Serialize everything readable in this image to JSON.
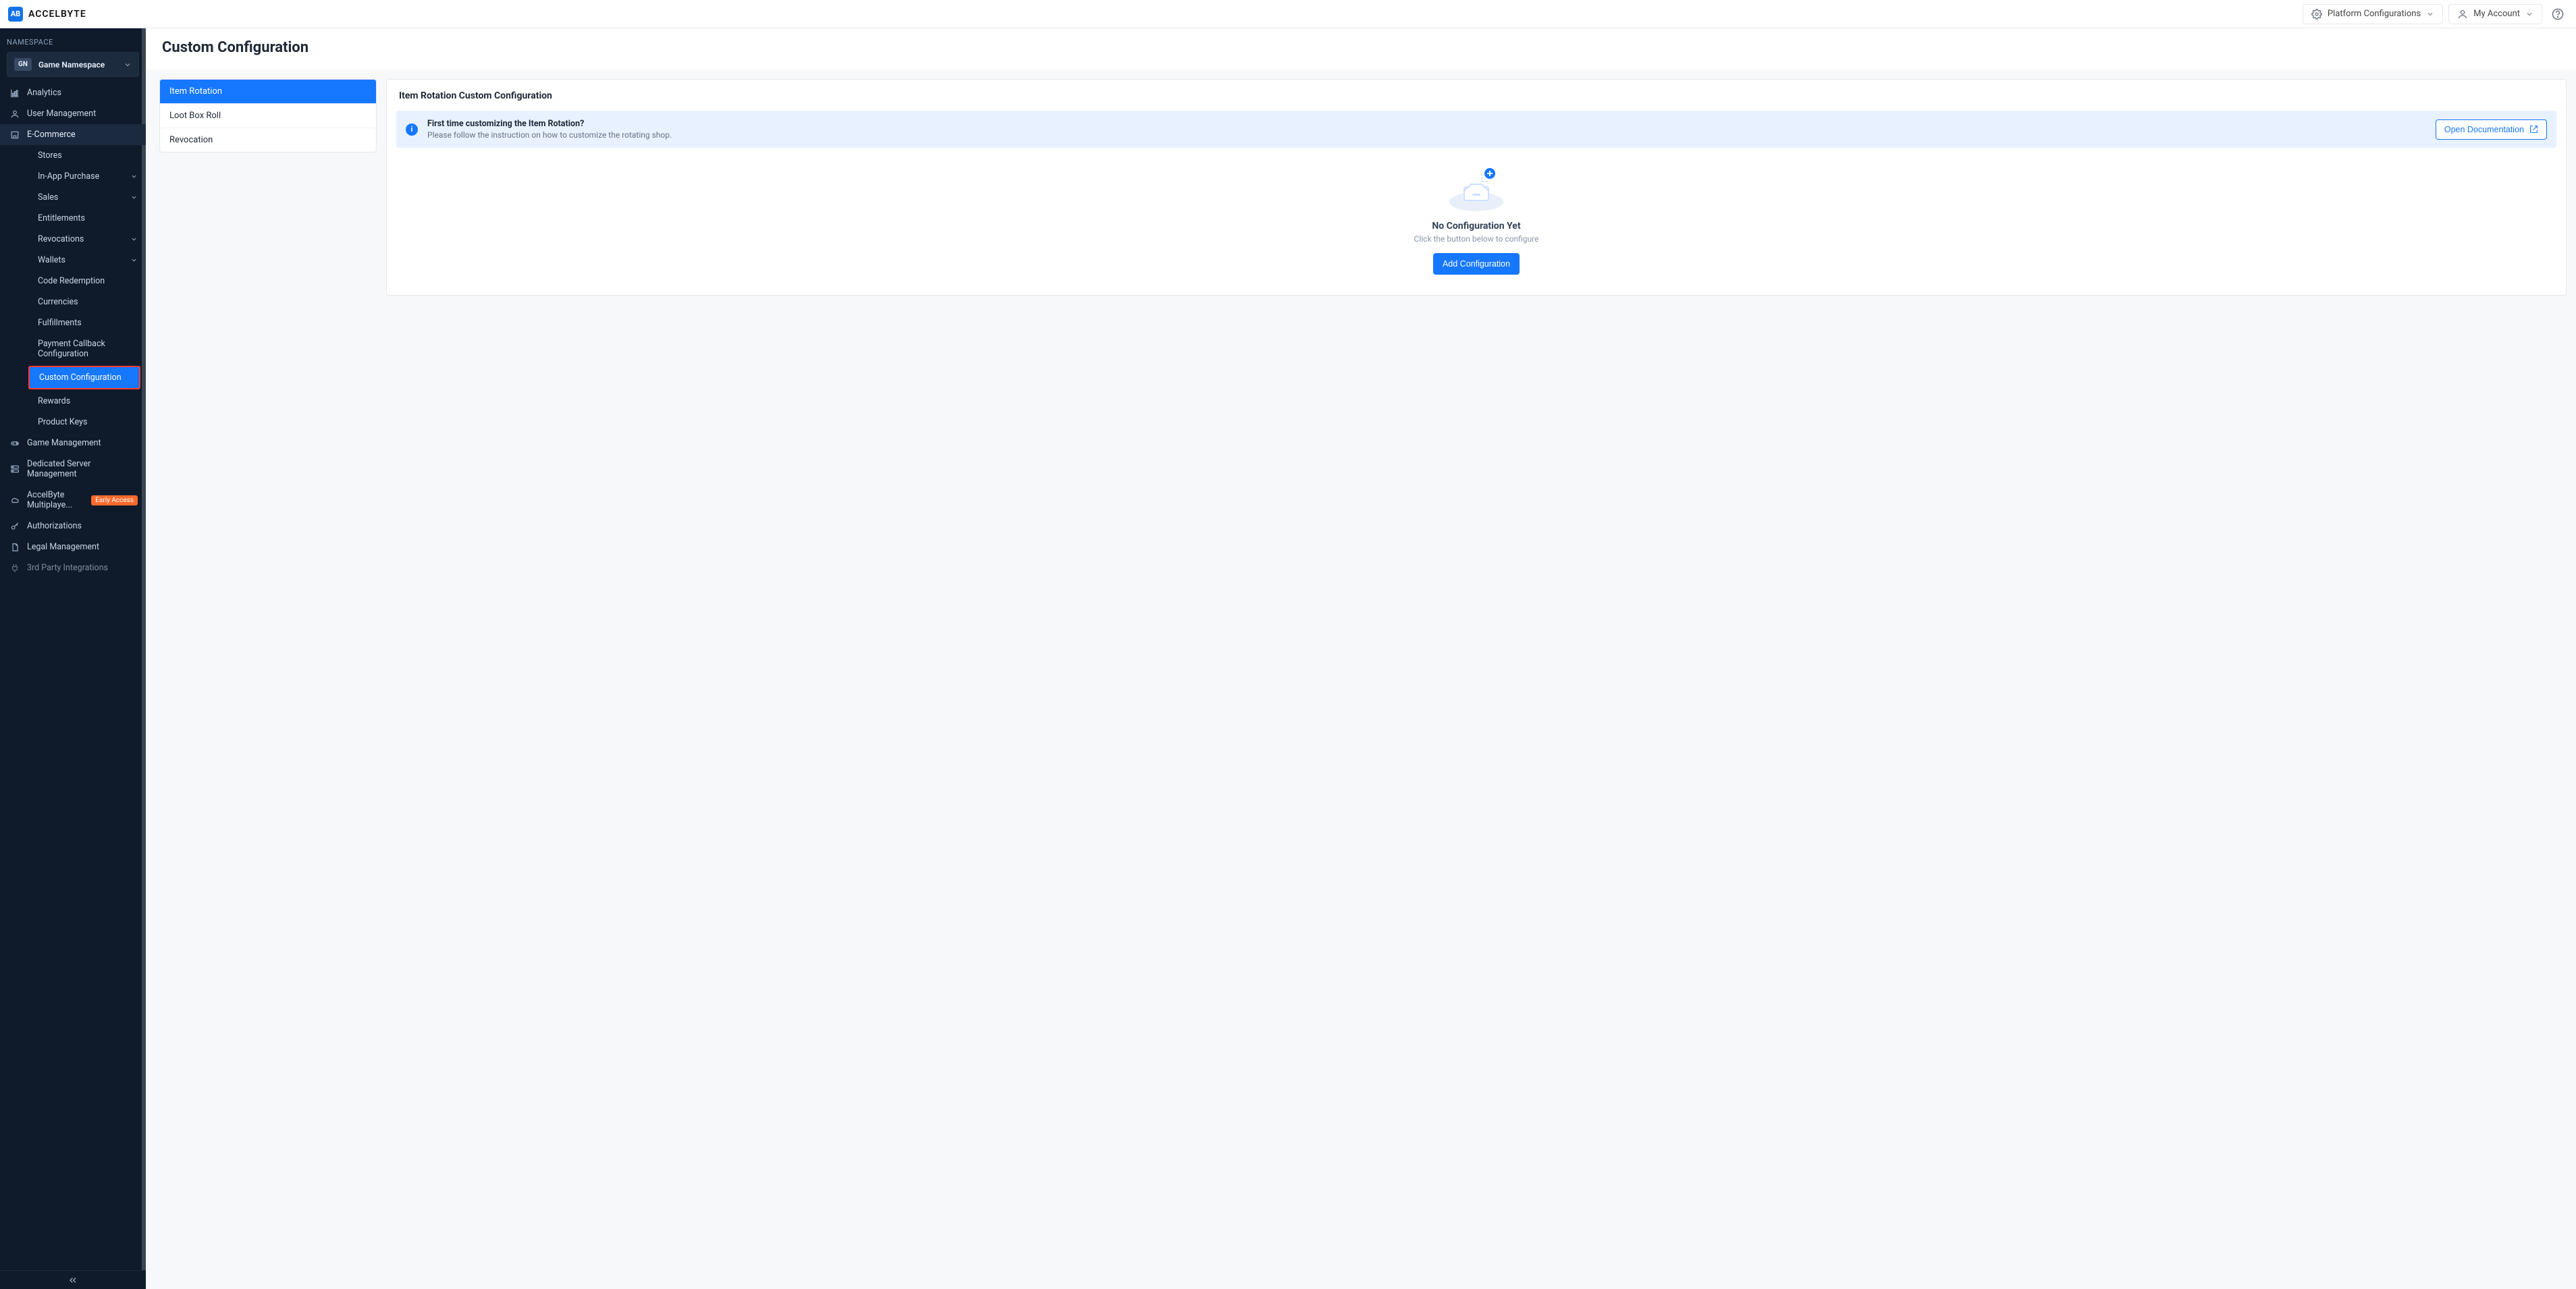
{
  "brand": {
    "logo_initials": "AB",
    "name": "ACCELBYTE"
  },
  "topbar": {
    "platform_configs_label": "Platform Configurations",
    "my_account_label": "My Account"
  },
  "sidebar": {
    "section_label": "NAMESPACE",
    "namespace_badge": "GN",
    "namespace_name": "Game Namespace",
    "items": [
      {
        "label": "Analytics"
      },
      {
        "label": "User Management"
      },
      {
        "label": "E-Commerce",
        "active": true
      },
      {
        "label": "Game Management"
      },
      {
        "label": "Dedicated Server Management"
      },
      {
        "label": "AccelByte Multiplaye...",
        "badge": "Early Access"
      },
      {
        "label": "Authorizations"
      },
      {
        "label": "Legal Management"
      },
      {
        "label": "3rd Party Integrations"
      }
    ],
    "ecommerce_children": [
      {
        "label": "Stores"
      },
      {
        "label": "In-App Purchase",
        "has_children": true
      },
      {
        "label": "Sales",
        "has_children": true
      },
      {
        "label": "Entitlements"
      },
      {
        "label": "Revocations",
        "has_children": true
      },
      {
        "label": "Wallets",
        "has_children": true
      },
      {
        "label": "Code Redemption"
      },
      {
        "label": "Currencies"
      },
      {
        "label": "Fulfillments"
      },
      {
        "label": "Payment Callback Configuration"
      },
      {
        "label": "Custom Configuration",
        "active": true
      },
      {
        "label": "Rewards"
      },
      {
        "label": "Product Keys"
      }
    ]
  },
  "page": {
    "title": "Custom Configuration"
  },
  "tabs": [
    {
      "label": "Item Rotation",
      "active": true
    },
    {
      "label": "Loot Box Roll"
    },
    {
      "label": "Revocation"
    }
  ],
  "panel": {
    "header": "Item Rotation Custom Configuration",
    "banner": {
      "question": "First time customizing the Item Rotation?",
      "desc": "Please follow the instruction on how to customize the rotating shop.",
      "open_docs_label": "Open Documentation"
    },
    "empty": {
      "title": "No Configuration Yet",
      "subtitle": "Click the button below to configure",
      "cta_label": "Add Configuration"
    }
  }
}
